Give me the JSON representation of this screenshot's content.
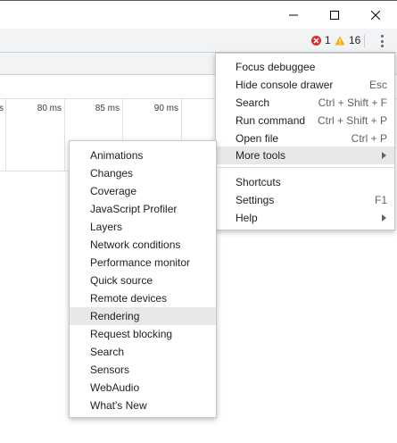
{
  "window": {
    "minimize_icon": "minimize-icon",
    "maximize_icon": "maximize-icon",
    "close_icon": "close-icon"
  },
  "toolbar": {
    "error_count": "1",
    "warning_count": "16",
    "colors": {
      "error": "#d93025",
      "warning": "#f9ab00"
    }
  },
  "timeline": {
    "ticks": [
      "s",
      "80 ms",
      "85 ms",
      "90 ms"
    ]
  },
  "main_menu": {
    "items": [
      {
        "label": "Focus debuggee",
        "shortcut": ""
      },
      {
        "label": "Hide console drawer",
        "shortcut": "Esc"
      },
      {
        "label": "Search",
        "shortcut": "Ctrl + Shift + F"
      },
      {
        "label": "Run command",
        "shortcut": "Ctrl + Shift + P"
      },
      {
        "label": "Open file",
        "shortcut": "Ctrl + P"
      },
      {
        "label": "More tools",
        "shortcut": "",
        "submenu": true
      },
      {
        "label": "Shortcuts",
        "shortcut": ""
      },
      {
        "label": "Settings",
        "shortcut": "F1"
      },
      {
        "label": "Help",
        "shortcut": "",
        "submenu": true
      }
    ]
  },
  "more_tools_menu": {
    "items": [
      "Animations",
      "Changes",
      "Coverage",
      "JavaScript Profiler",
      "Layers",
      "Network conditions",
      "Performance monitor",
      "Quick source",
      "Remote devices",
      "Rendering",
      "Request blocking",
      "Search",
      "Sensors",
      "WebAudio",
      "What's New"
    ]
  }
}
